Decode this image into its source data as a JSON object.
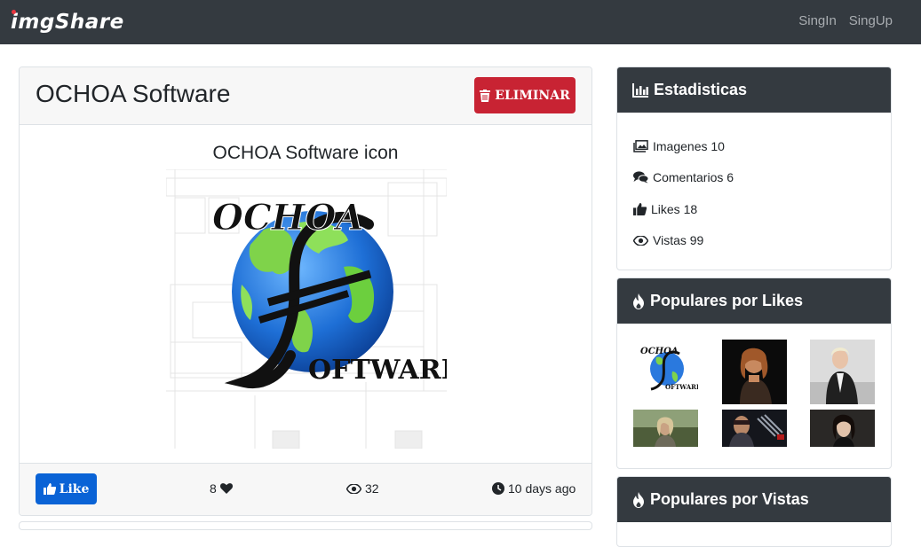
{
  "navbar": {
    "brand": "imgShare",
    "links": [
      "SingIn",
      "SingUp"
    ]
  },
  "image": {
    "title": "OCHOA Software",
    "delete_label": "ELIMINAR",
    "caption": "OCHOA Software icon",
    "logo_text_top": "OCHOA",
    "logo_text_bottom": "OFTWARE",
    "like_label": "Like",
    "likes": "8",
    "views": "32",
    "timestamp": "10 days ago"
  },
  "stats": {
    "title": "Estadisticas",
    "items": [
      {
        "icon": "images-icon",
        "label": "Imagenes 10"
      },
      {
        "icon": "comments-icon",
        "label": "Comentarios 6"
      },
      {
        "icon": "thumbs-up-icon",
        "label": "Likes 18"
      },
      {
        "icon": "eye-icon",
        "label": "Vistas 99"
      }
    ]
  },
  "popular_likes": {
    "title": "Populares por Likes"
  },
  "popular_views": {
    "title": "Populares por Vistas"
  },
  "colors": {
    "navbar": "#343a40",
    "danger": "#c82333",
    "primary": "#0a63d6"
  }
}
